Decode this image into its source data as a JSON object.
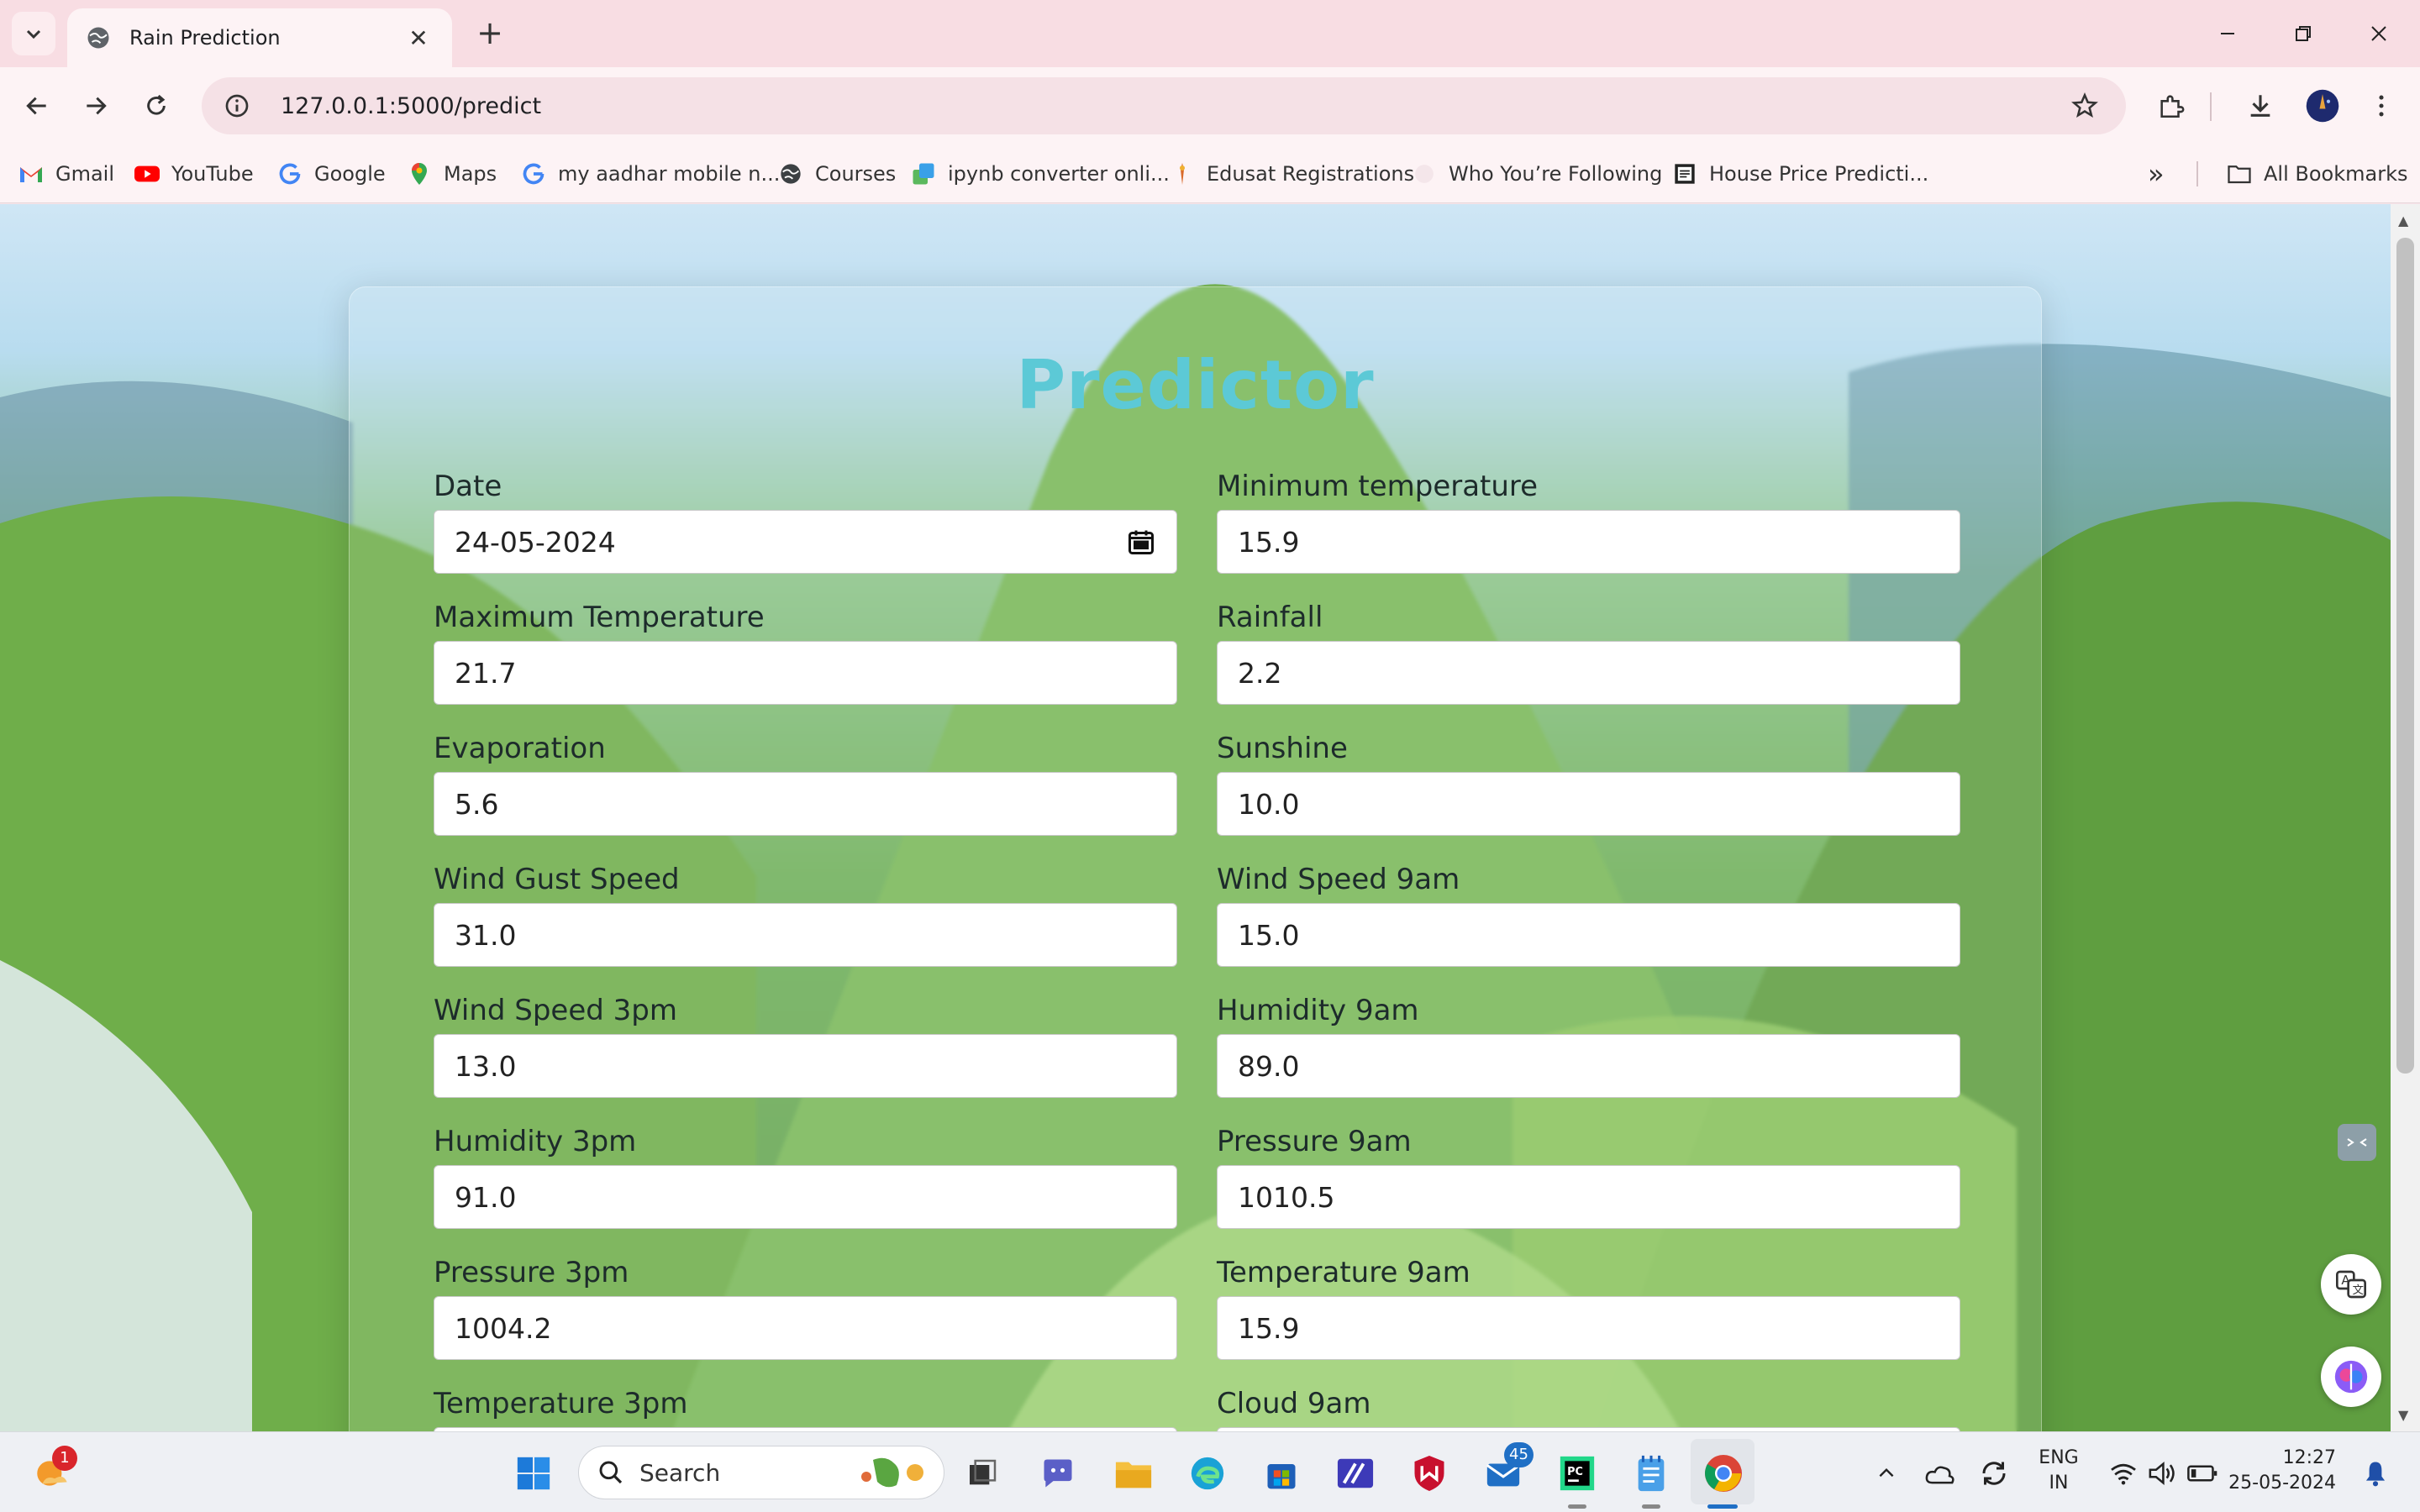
{
  "browser": {
    "tab_title": "Rain Prediction",
    "tab_close": "✕",
    "new_tab": "+",
    "url": "127.0.0.1:5000/predict",
    "bookmarks": [
      {
        "label": "Gmail",
        "icon": "gmail-icon"
      },
      {
        "label": "YouTube",
        "icon": "youtube-icon"
      },
      {
        "label": "Google",
        "icon": "google-icon"
      },
      {
        "label": "Maps",
        "icon": "maps-icon"
      },
      {
        "label": "my aadhar mobile n...",
        "icon": "google-icon"
      },
      {
        "label": "Courses",
        "icon": "globe-icon"
      },
      {
        "label": "ipynb converter onli...",
        "icon": "converter-icon"
      },
      {
        "label": "Edusat Registrations",
        "icon": "edusat-icon"
      },
      {
        "label": "Who You’re Following",
        "icon": "twitter-icon"
      },
      {
        "label": "House Price Predicti...",
        "icon": "page-icon"
      }
    ],
    "all_bookmarks": "All Bookmarks",
    "more_bookmarks": "»"
  },
  "page": {
    "title": "Predictor",
    "fields": [
      {
        "label": "Date",
        "value": "24-05-2024",
        "type": "date"
      },
      {
        "label": "Minimum temperature",
        "value": "15.9"
      },
      {
        "label": "Maximum Temperature",
        "value": "21.7"
      },
      {
        "label": "Rainfall",
        "value": "2.2"
      },
      {
        "label": "Evaporation",
        "value": "5.6"
      },
      {
        "label": "Sunshine",
        "value": "10.0"
      },
      {
        "label": "Wind Gust Speed",
        "value": "31.0"
      },
      {
        "label": "Wind Speed 9am",
        "value": "15.0"
      },
      {
        "label": "Wind Speed 3pm",
        "value": "13.0"
      },
      {
        "label": "Humidity 9am",
        "value": "89.0"
      },
      {
        "label": "Humidity 3pm",
        "value": "91.0"
      },
      {
        "label": "Pressure 9am",
        "value": "1010.5"
      },
      {
        "label": "Pressure 3pm",
        "value": "1004.2"
      },
      {
        "label": "Temperature 9am",
        "value": "15.9"
      },
      {
        "label": "Temperature 3pm",
        "value": ""
      },
      {
        "label": "Cloud 9am",
        "value": ""
      }
    ],
    "title_color": "#5cc9d6"
  },
  "taskbar": {
    "search_placeholder": "Search",
    "notification_badge": "1",
    "outlook_badge": "45",
    "lang_line1": "ENG",
    "lang_line2": "IN",
    "time": "12:27",
    "date": "25-05-2024"
  }
}
